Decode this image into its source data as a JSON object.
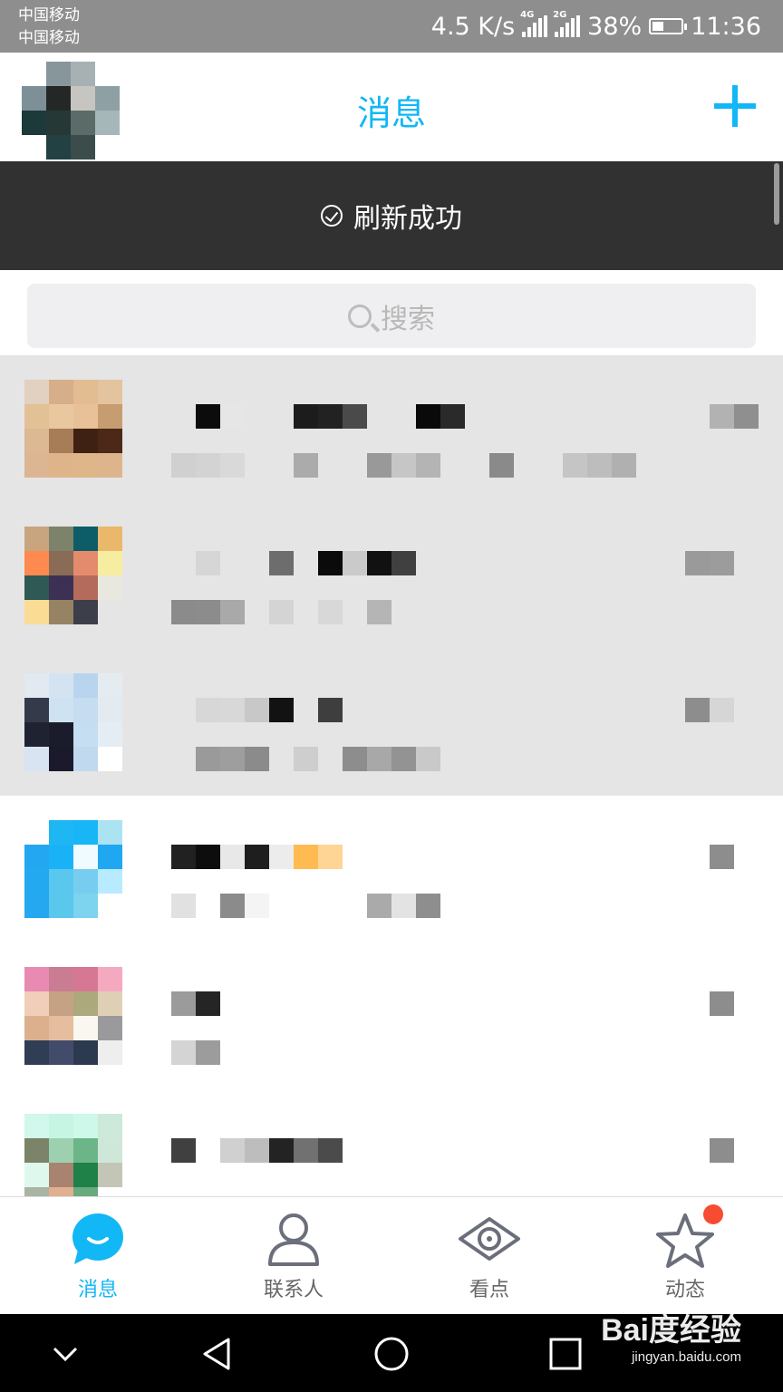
{
  "status_bar": {
    "carrier_1": "中国移动",
    "carrier_2": "中国移动",
    "net_speed": "4.5 K/s",
    "sim1_tag": "4G",
    "sim2_tag": "2G",
    "battery": "38%",
    "battery_level": 0.38,
    "time": "11:36"
  },
  "header": {
    "title": "消息"
  },
  "toast": {
    "text": "刷新成功"
  },
  "search": {
    "placeholder": "搜索"
  },
  "tabs": [
    {
      "label": "消息",
      "icon": "message-bubble-icon",
      "active": true
    },
    {
      "label": "联系人",
      "icon": "contacts-person-icon",
      "active": false
    },
    {
      "label": "看点",
      "icon": "eye-icon",
      "active": false
    },
    {
      "label": "动态",
      "icon": "star-icon",
      "active": false,
      "badge": true
    }
  ],
  "watermark": {
    "logo": "Bai度经验",
    "url": "jingyan.baidu.com"
  },
  "colors": {
    "accent": "#12b7f5",
    "toast_bg": "#313131",
    "pressed_bg": "#e5e5e5",
    "badge": "#f74c31"
  }
}
